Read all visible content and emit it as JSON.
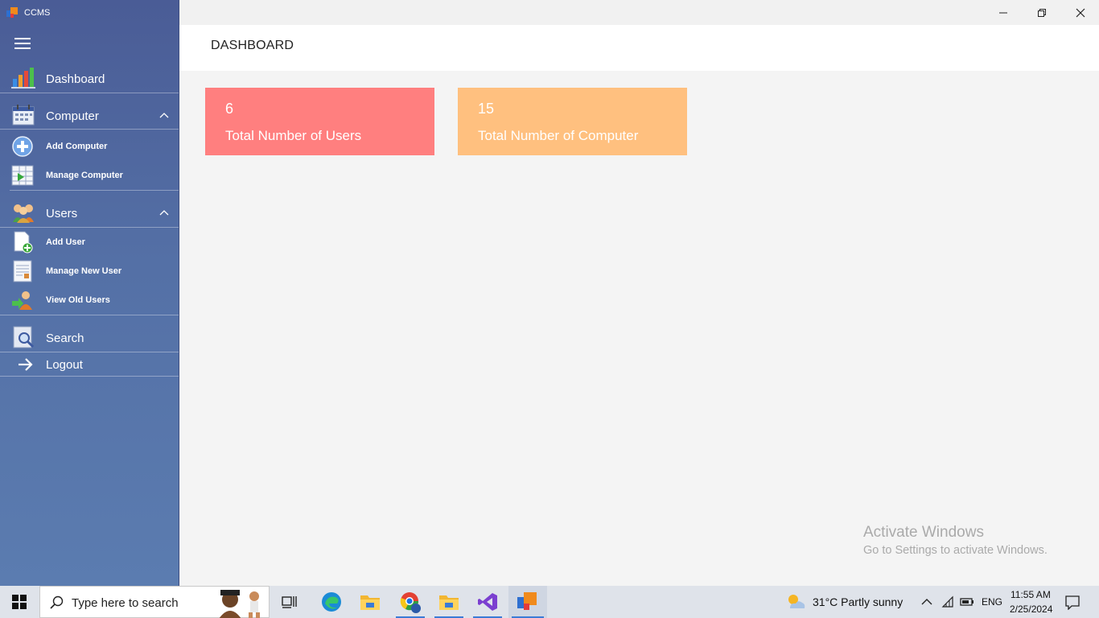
{
  "app": {
    "title": "CCMS"
  },
  "sidebar": {
    "dashboard": "Dashboard",
    "computer": {
      "label": "Computer",
      "items": [
        "Add Computer",
        "Manage Computer"
      ]
    },
    "users": {
      "label": "Users",
      "items": [
        "Add User",
        "Manage New User",
        "View Old Users"
      ]
    },
    "search": "Search",
    "logout": "Logout"
  },
  "header": {
    "title": "DASHBOARD"
  },
  "cards": [
    {
      "value": "6",
      "label": "Total Number of Users",
      "color": "#ff7f7f"
    },
    {
      "value": "15",
      "label": "Total Number of Computer",
      "color": "#ffc07f"
    }
  ],
  "watermark": {
    "line1": "Activate Windows",
    "line2": "Go to Settings to activate Windows."
  },
  "taskbar": {
    "search_placeholder": "Type here to search",
    "weather": "31°C  Partly sunny",
    "lang": "ENG",
    "time": "11:55 AM",
    "date": "2/25/2024"
  },
  "colors": {
    "sidebar": "#5470a6",
    "card_users": "#ff7f7f",
    "card_computers": "#ffc07f",
    "taskbar": "#dfe3ea"
  }
}
